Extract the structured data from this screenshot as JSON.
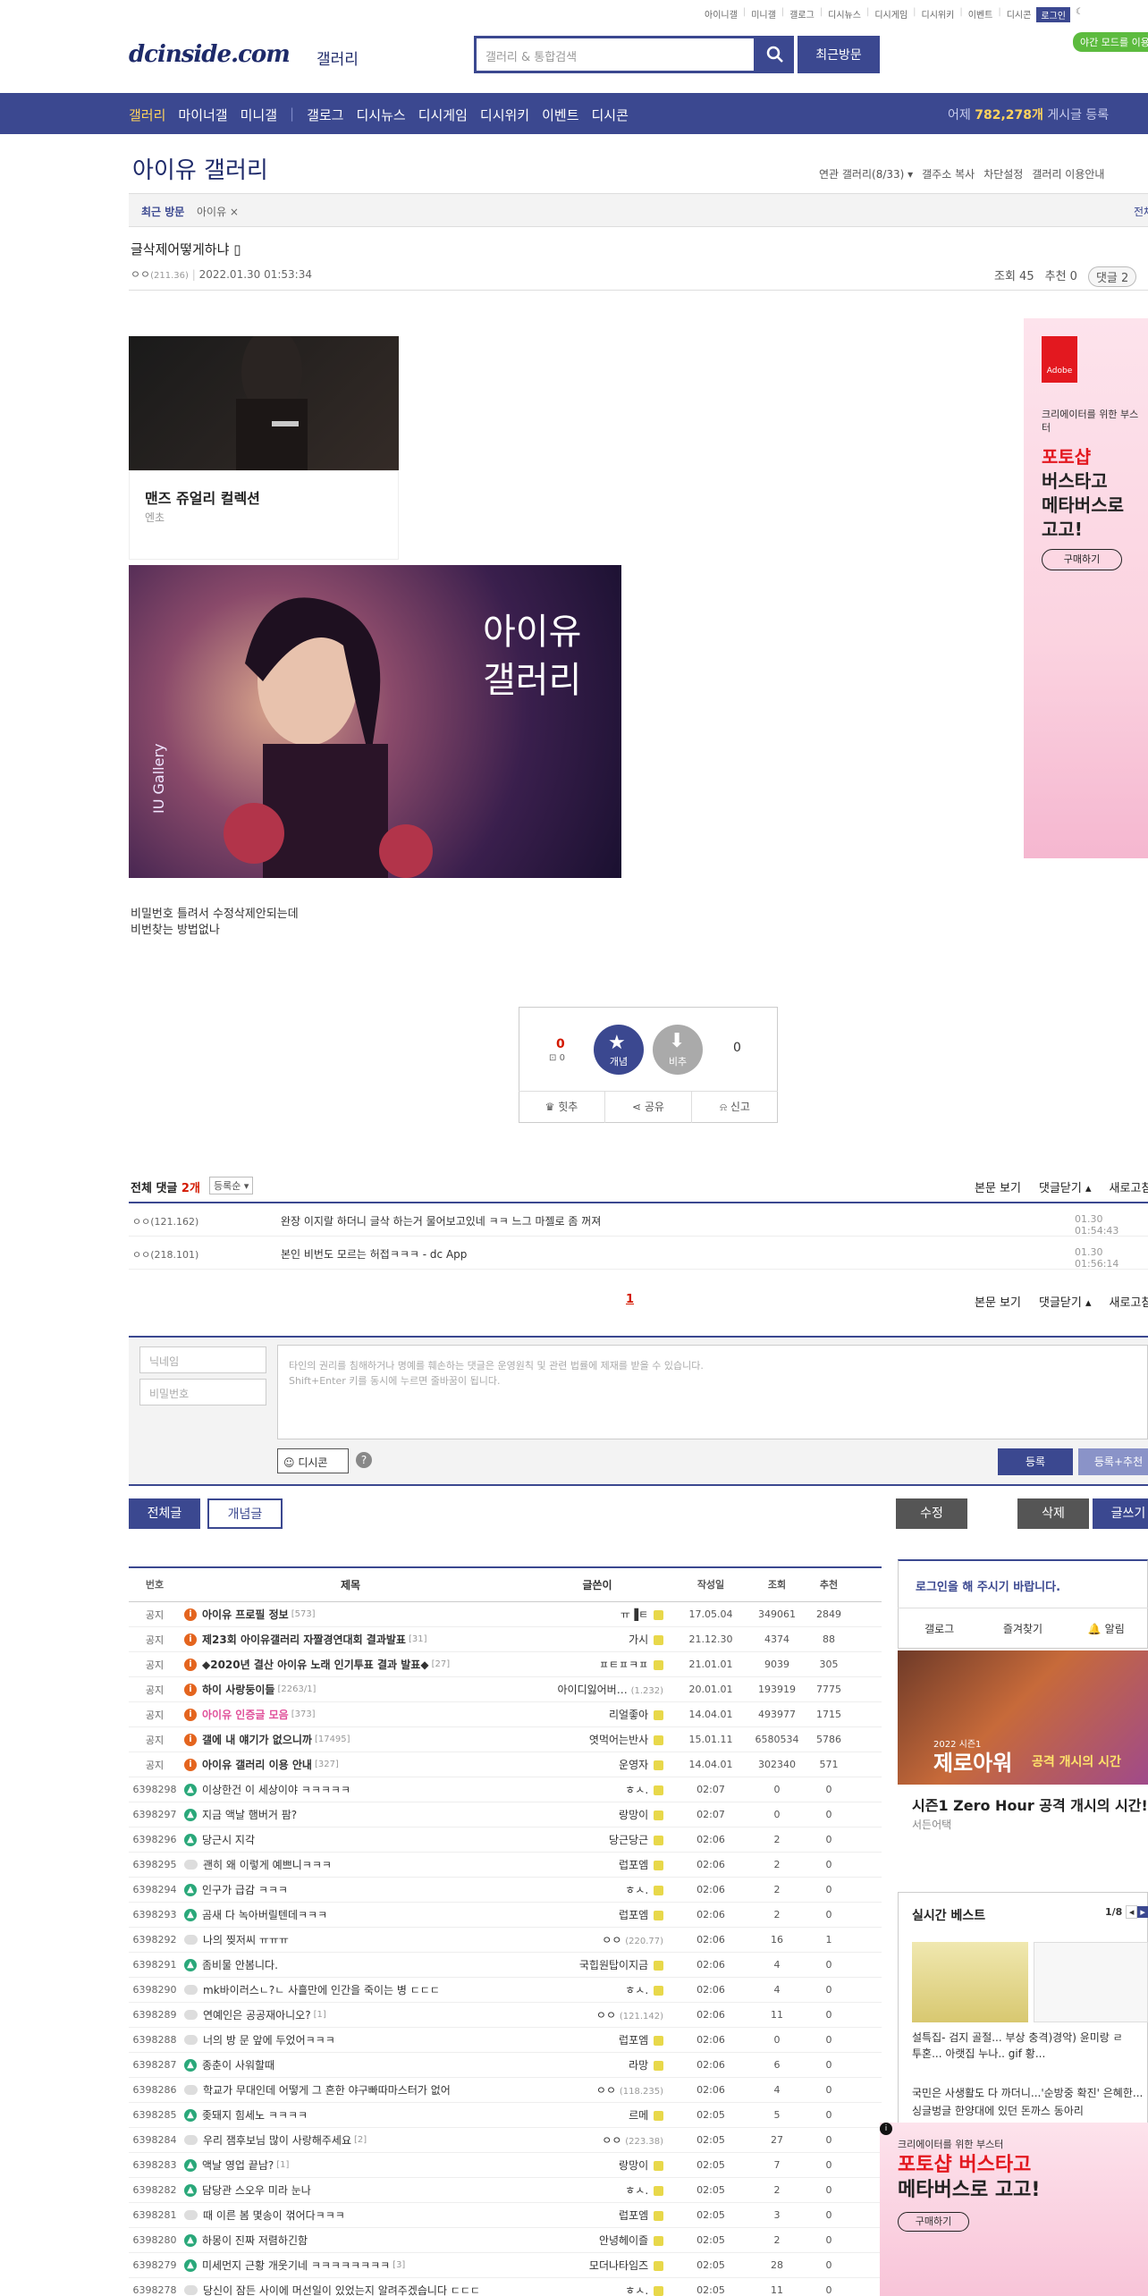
{
  "topmenu": [
    "아이니갤",
    "미니갤",
    "갤로그",
    "디시뉴스",
    "디시게임",
    "디시위키",
    "이벤트",
    "디시콘"
  ],
  "login_label": "로그인",
  "night_mode": "야간 모드를 이용해",
  "logo": "dcinside.com",
  "logo_sub": "갤러리",
  "search": {
    "placeholder": "갤러리 & 통합검색"
  },
  "recent_visit_btn": "최근방문",
  "gnb": {
    "items": [
      "갤러리",
      "마이너갤",
      "미니갤",
      "갤로그",
      "디시뉴스",
      "디시게임",
      "디시위키",
      "이벤트",
      "디시콘"
    ],
    "count_prefix": "어제 ",
    "count_value": "782,278개",
    "count_suffix": " 게시글 등록"
  },
  "gallery_title": "아이유 갤러리",
  "gallery_tools": [
    "연관 갤러리(8/33) ▾",
    "갤주소 복사",
    "차단설정",
    "갤러리 이용안내"
  ],
  "visit": {
    "label": "최근 방문",
    "item": "아이유 ×",
    "all": "전체"
  },
  "post": {
    "title": "글삭제어떻게하냐",
    "author": "ㅇㅇ",
    "ip": "(211.36)",
    "date": "2022.01.30 01:53:34",
    "views": "조회 45",
    "recommends": "추천 0",
    "comments": "댓글 2",
    "body_line1": "비밀번호 틀려서 수정삭제안되는데",
    "body_line2": "비번찾는 방법없나"
  },
  "ad1": {
    "title": "맨즈 쥬얼리 컬렉션",
    "sub": "엔초"
  },
  "hero": {
    "text_line1": "아이유",
    "text_line2": "갤러리",
    "side": "IU Gallery"
  },
  "ad_right": {
    "brand": "Adobe",
    "t1": "크리에이터를 위한 부스터",
    "t2_line1": "포토샵",
    "t2_line2": "버스타고",
    "t2_line3": "메타버스로",
    "t2_line4": "고고!",
    "btn": "구매하기"
  },
  "rec": {
    "up": "0",
    "up_fix": "0",
    "gae": "개념",
    "bi": "비추",
    "down": "0",
    "bottom": [
      "힛추",
      "공유",
      "신고"
    ]
  },
  "comments": {
    "head": "전체 댓글",
    "count": "2개",
    "sort": "등록순 ▾",
    "right": [
      "본문 보기",
      "댓글닫기 ▴",
      "새로고침"
    ],
    "rows": [
      {
        "author": "ㅇㅇ(121.162)",
        "text": "완장 이지랄 하더니 글삭 하는거 물어보고있네 ㅋㅋ 느그 마젤로 좀 꺼져",
        "date": "01.30 01:54:43"
      },
      {
        "author": "ㅇㅇ(218.101)",
        "text": "본인 비번도 모르는 허접ㅋㅋㅋ - dc App",
        "date": "01.30 01:56:14"
      }
    ],
    "page": "1"
  },
  "form": {
    "nick_ph": "닉네임",
    "pw_ph": "비밀번호",
    "ta_line1": "타인의 권리를 침해하거나 명예를 훼손하는 댓글은 운영원칙 및 관련 법률에 제재를 받을 수 있습니다.",
    "ta_line2": "Shift+Enter 키를 동시에 누르면 줄바꿈이 됩니다.",
    "dccon": "디시콘",
    "help": "?",
    "reg": "등록",
    "regplus": "등록+추천"
  },
  "list_tabs": {
    "all": "전체글",
    "gae": "개념글",
    "edit": "수정",
    "del": "삭제",
    "write": "글쓰기"
  },
  "table": {
    "headers": [
      "번호",
      "제목",
      "글쓴이",
      "작성일",
      "조회",
      "추천"
    ],
    "rows": [
      {
        "no": "공지",
        "type": "n",
        "title": "아이유 프로필 정보",
        "cc": "[573]",
        "writer": "ㅠ▐ㅌ",
        "date": "17.05.04",
        "views": "349061",
        "rec": "2849",
        "notice": true
      },
      {
        "no": "공지",
        "type": "n",
        "title": "제23회 아이유갤러리 자짤경연대회 결과발표",
        "cc": "[31]",
        "writer": "가시",
        "date": "21.12.30",
        "views": "4374",
        "rec": "88",
        "notice": true
      },
      {
        "no": "공지",
        "type": "n",
        "title": "◆2020년 결산 아이유 노래 인기투표 결과 발표◆",
        "cc": "[27]",
        "writer": "ㅍㅌㅍㅋㅍ",
        "date": "21.01.01",
        "views": "9039",
        "rec": "305",
        "notice": true
      },
      {
        "no": "공지",
        "type": "n",
        "title": "하이 사랑둥이들",
        "cc": "[2263/1]",
        "writer": "아이디잃어버…",
        "wip": "(1.232)",
        "date": "20.01.01",
        "views": "193919",
        "rec": "7775",
        "notice": true
      },
      {
        "no": "공지",
        "type": "n",
        "title": "아이유 인증글 모음",
        "cc": "[373]",
        "writer": "리얼좋아",
        "date": "14.04.01",
        "views": "493977",
        "rec": "1715",
        "notice": true,
        "pink": true
      },
      {
        "no": "공지",
        "type": "n",
        "title": "갤에 내 얘기가 없으니까",
        "cc": "[17495]",
        "writer": "엿먹어는반사",
        "date": "15.01.11",
        "views": "6580534",
        "rec": "5786",
        "notice": true
      },
      {
        "no": "공지",
        "type": "n",
        "title": "아이유 갤러리 이용 안내",
        "cc": "[327]",
        "writer": "운영자",
        "date": "14.04.01",
        "views": "302340",
        "rec": "571",
        "notice": true
      },
      {
        "no": "6398298",
        "type": "p",
        "title": "이상한건 이 세상이야 ㅋㅋㅋㅋㅋ",
        "cc": "",
        "writer": "ㅎㅅ.",
        "date": "02:07",
        "views": "0",
        "rec": "0"
      },
      {
        "no": "6398297",
        "type": "p",
        "title": "지금 액날 햄버거 팜?",
        "cc": "",
        "writer": "랑망이",
        "date": "02:07",
        "views": "0",
        "rec": "0"
      },
      {
        "no": "6398296",
        "type": "p",
        "title": "당근시 지각",
        "cc": "",
        "writer": "당근당근",
        "date": "02:06",
        "views": "2",
        "rec": "0"
      },
      {
        "no": "6398295",
        "type": "c",
        "title": "괜히 왜 이렇게 예쁘니ㅋㅋㅋ",
        "cc": "",
        "writer": "럽포엠",
        "date": "02:06",
        "views": "2",
        "rec": "0"
      },
      {
        "no": "6398294",
        "type": "p",
        "title": "인구가 급감 ㅋㅋㅋ",
        "cc": "",
        "writer": "ㅎㅅ.",
        "date": "02:06",
        "views": "2",
        "rec": "0"
      },
      {
        "no": "6398293",
        "type": "p",
        "title": "곰새 다 녹아버릴텐데ㅋㅋㅋ",
        "cc": "",
        "writer": "럽포엠",
        "date": "02:06",
        "views": "2",
        "rec": "0"
      },
      {
        "no": "6398292",
        "type": "c",
        "title": "나의 찢저씨 ㅠㅠㅠ",
        "cc": "",
        "writer": "ㅇㅇ",
        "wip": "(220.77)",
        "date": "02:06",
        "views": "16",
        "rec": "1"
      },
      {
        "no": "6398291",
        "type": "p",
        "title": "좀비물 안봄니다.",
        "cc": "",
        "writer": "국힙원탑이지금",
        "date": "02:06",
        "views": "4",
        "rec": "0"
      },
      {
        "no": "6398290",
        "type": "c",
        "title": "mk바이러스ㄴ?ㄴ 사흘만에 인간을 죽이는 병 ㄷㄷㄷ",
        "cc": "",
        "writer": "ㅎㅅ.",
        "date": "02:06",
        "views": "4",
        "rec": "0"
      },
      {
        "no": "6398289",
        "type": "c",
        "title": "연예인은 공공재아니오?",
        "cc": "[1]",
        "writer": "ㅇㅇ",
        "wip": "(121.142)",
        "date": "02:06",
        "views": "11",
        "rec": "0"
      },
      {
        "no": "6398288",
        "type": "c",
        "title": "너의 방 문 앞에 두었어ㅋㅋㅋ",
        "cc": "",
        "writer": "럽포엠",
        "date": "02:06",
        "views": "0",
        "rec": "0"
      },
      {
        "no": "6398287",
        "type": "p",
        "title": "종춘이 사워할때",
        "cc": "",
        "writer": "라망",
        "date": "02:06",
        "views": "6",
        "rec": "0"
      },
      {
        "no": "6398286",
        "type": "c",
        "title": "학교가 무대인데 어떻게 그 흔한 야구빠따마스터가 없어",
        "cc": "",
        "writer": "ㅇㅇ",
        "wip": "(118.235)",
        "date": "02:06",
        "views": "4",
        "rec": "0"
      },
      {
        "no": "6398285",
        "type": "p",
        "title": "좆돼지 힘세노 ㅋㅋㅋㅋ",
        "cc": "",
        "writer": "르메",
        "date": "02:05",
        "views": "5",
        "rec": "0"
      },
      {
        "no": "6398284",
        "type": "c",
        "title": "우리 잼후보님 많이 사랑해주세요",
        "cc": "[2]",
        "writer": "ㅇㅇ",
        "wip": "(223.38)",
        "date": "02:05",
        "views": "27",
        "rec": "0"
      },
      {
        "no": "6398283",
        "type": "p",
        "title": "액날 영업 끝남?",
        "cc": "[1]",
        "writer": "랑망이",
        "date": "02:05",
        "views": "7",
        "rec": "0"
      },
      {
        "no": "6398282",
        "type": "p",
        "title": "담당관 스오우 미라 눈나",
        "cc": "",
        "writer": "ㅎㅅ.",
        "date": "02:05",
        "views": "2",
        "rec": "0"
      },
      {
        "no": "6398281",
        "type": "c",
        "title": "때 이른 봄 몇송이 꺾어다ㅋㅋㅋ",
        "cc": "",
        "writer": "럽포엠",
        "date": "02:05",
        "views": "3",
        "rec": "0"
      },
      {
        "no": "6398280",
        "type": "p",
        "title": "하몽이 진짜 저렴하긴함",
        "cc": "",
        "writer": "안녕헤이즐",
        "date": "02:05",
        "views": "2",
        "rec": "0"
      },
      {
        "no": "6398279",
        "type": "p",
        "title": "미세먼지 근황 개웃기네 ㅋㅋㅋㅋㅋㅋㅋㅋ",
        "cc": "[3]",
        "writer": "모더나타임즈",
        "date": "02:05",
        "views": "28",
        "rec": "0"
      },
      {
        "no": "6398278",
        "type": "c",
        "title": "당신이 잠든 사이에 머선일이 있었는지 알려주겠습니다 ㄷㄷㄷ",
        "cc": "",
        "writer": "ㅎㅅ.",
        "date": "02:05",
        "views": "11",
        "rec": "0"
      }
    ]
  },
  "side": {
    "login_msg": "로그인을 해 주시기 바랍니다.",
    "links": [
      "갤로그",
      "즐겨찾기",
      "알림"
    ],
    "ad_badge": "2022 시즌1",
    "ad_headline": "제로아워",
    "ad_sub": "공격 개시의 시간",
    "ad_title": "시즌1 Zero Hour 공격 개시의 시간!",
    "ad_brand": "서든어택",
    "best_title": "실시간 베스트",
    "best_page": "1/8",
    "best_lines": [
      "설특집- 검지 골절... 부상 충격)경악) 윤미랑 ㄹ",
      "투혼... 아랫집 누나.. gif 황...",
      "국민은 사생활도 다 까더니...'순방중 확진' 은혜한...",
      "싱글벙글 한양대에 있던 돈까스 동아리"
    ],
    "ad4_t1": "크리에이터를 위한 부스터",
    "ad4_t2_line1": "포토샵 버스타고",
    "ad4_t2_line2": "메타버스로 고고!",
    "ad4_btn": "구매하기"
  },
  "colors": {
    "brand": "#3b4890",
    "accent": "#ffd35c",
    "alert": "#d31900"
  }
}
